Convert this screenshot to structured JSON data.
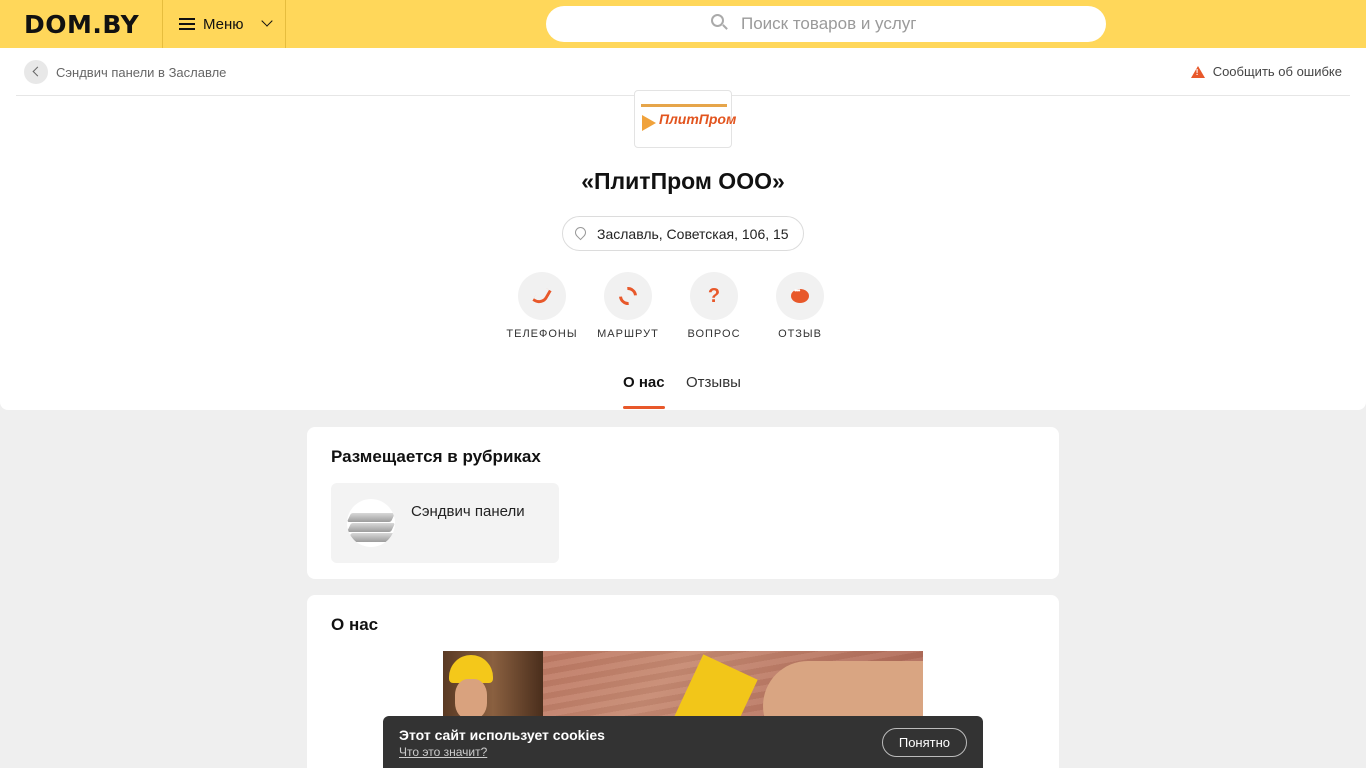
{
  "header": {
    "logo": "DOM.BY",
    "menu_label": "Меню",
    "search_placeholder": "Поиск товаров и услуг"
  },
  "breadcrumb": {
    "text": "Сэндвич панели в Заславле"
  },
  "report": {
    "label": "Сообщить об ошибке"
  },
  "company": {
    "logo_text": "ПлитПром",
    "name": "«ПлитПром ООО»",
    "address": "Заславль, Советская, 106, 15"
  },
  "actions": [
    {
      "label": "ТЕЛЕФОНЫ",
      "icon": "phone-icon"
    },
    {
      "label": "МАРШРУТ",
      "icon": "route-icon"
    },
    {
      "label": "ВОПРОС",
      "icon": "question-icon",
      "glyph": "?"
    },
    {
      "label": "ОТЗЫВ",
      "icon": "review-icon"
    }
  ],
  "tabs": [
    {
      "label": "О нас",
      "active": true
    },
    {
      "label": "Отзывы",
      "active": false
    }
  ],
  "rubrics": {
    "title": "Размещается в рубриках",
    "items": [
      {
        "label": "Сэндвич панели"
      }
    ]
  },
  "about": {
    "title": "О нас"
  },
  "cookie": {
    "message": "Этот сайт использует cookies",
    "link": "Что это значит?",
    "button": "Понятно"
  },
  "colors": {
    "header": "#ffd75a",
    "accent": "#e8582a"
  }
}
